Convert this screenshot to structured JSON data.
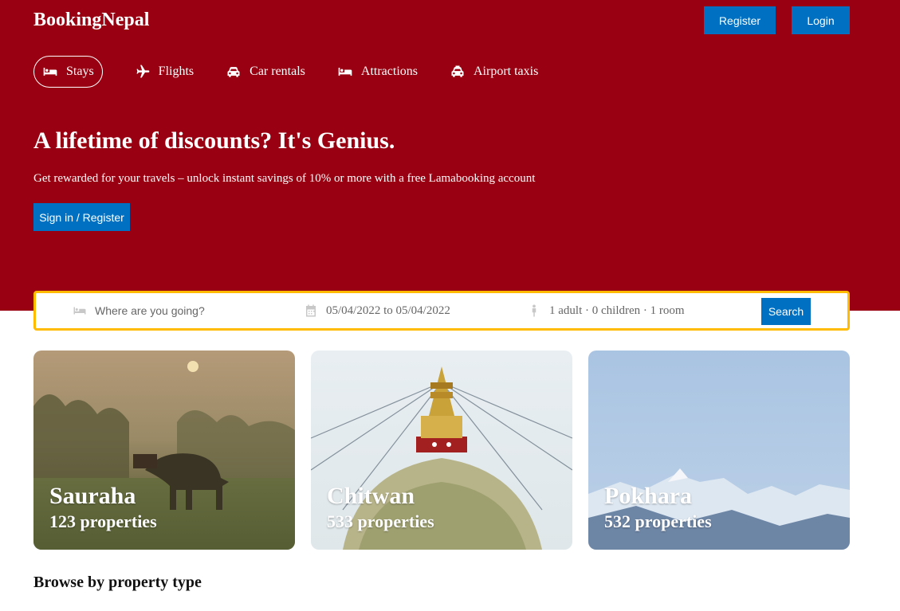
{
  "header": {
    "logo": "BookingNepal",
    "register_label": "Register",
    "login_label": "Login"
  },
  "nav": {
    "items": [
      {
        "label": "Stays",
        "icon": "bed-icon",
        "active": true
      },
      {
        "label": "Flights",
        "icon": "plane-icon",
        "active": false
      },
      {
        "label": "Car rentals",
        "icon": "car-icon",
        "active": false
      },
      {
        "label": "Attractions",
        "icon": "bed-icon",
        "active": false
      },
      {
        "label": "Airport taxis",
        "icon": "taxi-icon",
        "active": false
      }
    ]
  },
  "hero": {
    "title": "A lifetime of discounts? It's Genius.",
    "description": "Get rewarded for your travels – unlock instant savings of 10% or more with a free Lamabooking account",
    "signin_label": "Sign in / Register"
  },
  "search": {
    "destination_placeholder": "Where are you going?",
    "dates": "05/04/2022 to 05/04/2022",
    "options": "1 adult · 0 children · 1 room",
    "button_label": "Search"
  },
  "featured": [
    {
      "city": "Sauraha",
      "properties": "123 properties"
    },
    {
      "city": "Chitwan",
      "properties": "533 properties"
    },
    {
      "city": "Pokhara",
      "properties": "532 properties"
    }
  ],
  "sections": {
    "browse_title": "Browse by property type"
  },
  "colors": {
    "hero_bg": "#990011",
    "button_blue": "#0071c2",
    "search_border": "#febb02"
  }
}
